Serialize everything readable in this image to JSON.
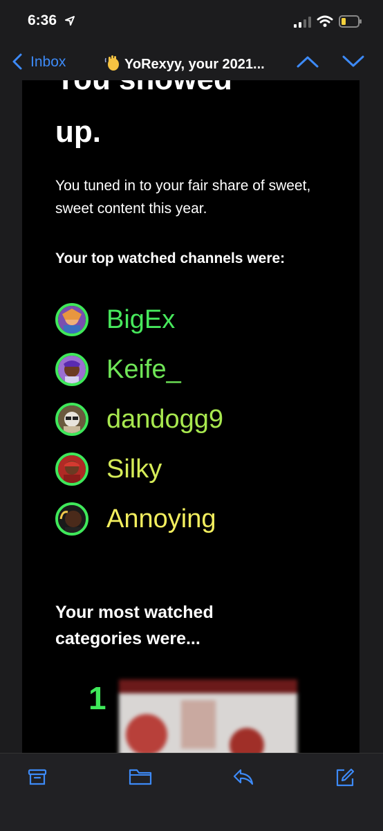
{
  "status": {
    "time": "6:36"
  },
  "nav": {
    "back_label": "Inbox",
    "subject": "YoRexyy, your 2021..."
  },
  "email": {
    "hero_cut": "You showed",
    "hero": "up.",
    "paragraph": "You tuned in to your fair share of sweet, sweet content this year.",
    "top_heading": "Your top watched channels were:",
    "channels": [
      {
        "name": "BigEx",
        "color": "#47e85c"
      },
      {
        "name": "Keife_",
        "color": "#6fe657"
      },
      {
        "name": "dandogg9",
        "color": "#a8e84f"
      },
      {
        "name": "Silky",
        "color": "#d6ec58"
      },
      {
        "name": "Annoying",
        "color": "#f2ee5e"
      }
    ],
    "categories_heading": "Your most watched categories were...",
    "category_rank": "1"
  },
  "colors": {
    "accent": "#3d8af7",
    "ring": "#3fe85a",
    "background": "#000000"
  },
  "toolbar": {
    "icons": [
      "archive-icon",
      "folder-icon",
      "reply-icon",
      "compose-icon"
    ]
  }
}
